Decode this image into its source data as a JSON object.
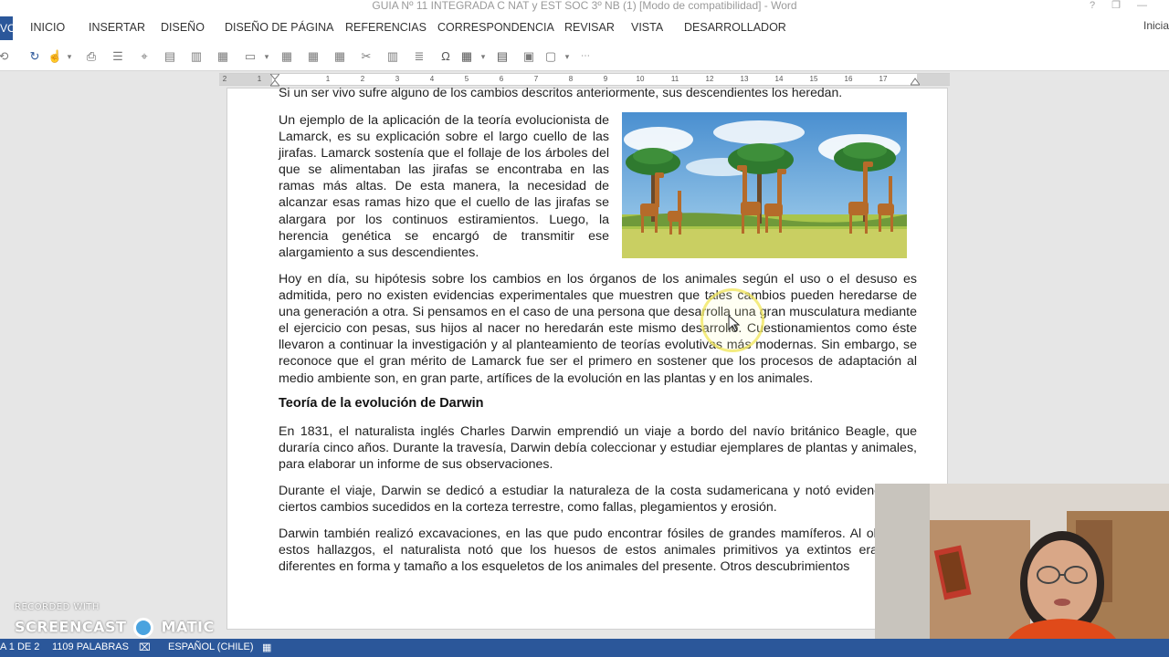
{
  "window": {
    "title": "GUIA Nº 11 INTEGRADA C NAT y EST SOC 3º NB (1) [Modo de compatibilidad] - Word",
    "controls": [
      "?",
      "❐",
      "—"
    ]
  },
  "ribbon": {
    "file_tab_label": "VO",
    "tabs": [
      "INICIO",
      "INSERTAR",
      "DISEÑO",
      "DISEÑO DE PÁGINA",
      "REFERENCIAS",
      "CORRESPONDENCIA",
      "REVISAR",
      "VISTA",
      "DESARROLLADOR"
    ],
    "signin_label": "Inicia"
  },
  "quick_access_icons": [
    "refresh-icon",
    "touch-mode-icon",
    "print-icon",
    "align-icon",
    "anchor-icon",
    "table-icon",
    "grid-icon",
    "textbox-icon",
    "symbol-omega-icon",
    "table-insert-icon",
    "shape-icon",
    "more-icon"
  ],
  "ruler": {
    "labels": [
      "2",
      "1",
      "1",
      "2",
      "3",
      "4",
      "5",
      "6",
      "7",
      "8",
      "9",
      "10",
      "11",
      "12",
      "13",
      "14",
      "15",
      "16",
      "17"
    ]
  },
  "document": {
    "cut_line": "Si un ser vivo sufre alguno de los cambios descritos anteriormente, sus descendientes los heredan.",
    "para_lamarck": "Un ejemplo de la aplicación de la teoría evolucionista de Lamarck, es su explicación sobre el largo cuello de las jirafas. Lamarck sostenía que el follaje de los árboles del que se alimentaban las jirafas se encontraba en las ramas más altas. De esta manera, la necesidad de alcanzar esas ramas hizo que el cuello de las jirafas se alargara por los continuos estiramientos. Luego, la herencia genética se encargó de transmitir ese alargamiento a sus descendientes.",
    "para_hoy": "Hoy en día, su hipótesis sobre los cambios en los órganos de los animales según el uso o el desuso es admitida, pero no existen evidencias experimentales que muestren que tales cambios pueden heredarse de una generación a otra. Si pensamos en el caso de una persona que desarrolla una gran musculatura mediante el ejercicio con pesas, sus hijos al nacer no heredarán este mismo desarrollo. Cuestionamientos como éste llevaron a continuar la investigación y al planteamiento de teorías evolutivas más modernas. Sin embargo, se reconoce que el gran mérito de Lamarck fue ser el primero en sostener que los procesos de adaptación al medio ambiente son, en gran parte, artífices de la evolución en las plantas y en los animales.",
    "heading_darwin": "Teoría de la evolución de Darwin",
    "para_1831": "En 1831, el naturalista inglés Charles Darwin emprendió un viaje a bordo del navío británico Beagle, que duraría cinco años. Durante la travesía, Darwin debía coleccionar y estudiar ejemplares de plantas y animales, para elaborar un informe de sus observaciones.",
    "para_viaje": "Durante el viaje, Darwin se dedicó a estudiar la naturaleza de la costa sudamericana y notó evidencias de ciertos cambios sucedidos en la corteza terrestre, como fallas, plegamientos y erosión.",
    "para_excav": "Darwin también realizó excavaciones, en las que pudo encontrar fósiles de grandes mamíferos. Al observar estos hallazgos, el naturalista notó que los huesos de estos animales primitivos ya extintos eran muy diferentes en forma y tamaño a los esqueletos de los animales del presente. Otros descubrimientos"
  },
  "statusbar": {
    "page": "A 1 DE 2",
    "words": "1109 PALABRAS",
    "language": "ESPAÑOL (CHILE)"
  },
  "watermark": {
    "line1": "RECORDED WITH",
    "line2": "SCREENCAST",
    "line3": "MATIC"
  },
  "colors": {
    "word_blue": "#2b579a",
    "cursor_highlight": "#f0e65a"
  }
}
